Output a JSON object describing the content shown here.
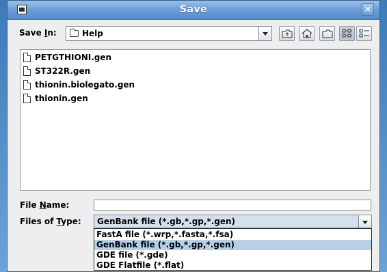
{
  "window": {
    "title": "Save",
    "close_label": "✕"
  },
  "save_in": {
    "label_pre": "Save ",
    "label_mnemonic": "I",
    "label_post": "n:",
    "value": "Help"
  },
  "toolbar": {
    "buttons": [
      "up-one-level",
      "home",
      "new-folder",
      "list-view",
      "details-view"
    ]
  },
  "files": [
    "PETGTHIONI.gen",
    "ST322R.gen",
    "thionin.biolegato.gen",
    "thionin.gen"
  ],
  "file_name": {
    "label_pre": "File ",
    "label_mnemonic": "N",
    "label_post": "ame:",
    "value": ""
  },
  "file_type": {
    "label_pre": "Files of ",
    "label_mnemonic": "T",
    "label_post": "ype:",
    "value": "GenBank file (*.gb,*.gp,*.gen)",
    "options": [
      "FastA file (*.wrp,*.fasta,*.fsa)",
      "GenBank file (*.gb,*.gp,*.gen)",
      "GDE file (*.gde)",
      "GDE Flatfile (*.flat)"
    ],
    "selected_index": 1
  },
  "colors": {
    "title_bar": "#6e9fd9",
    "selection": "#b8cfe5"
  }
}
